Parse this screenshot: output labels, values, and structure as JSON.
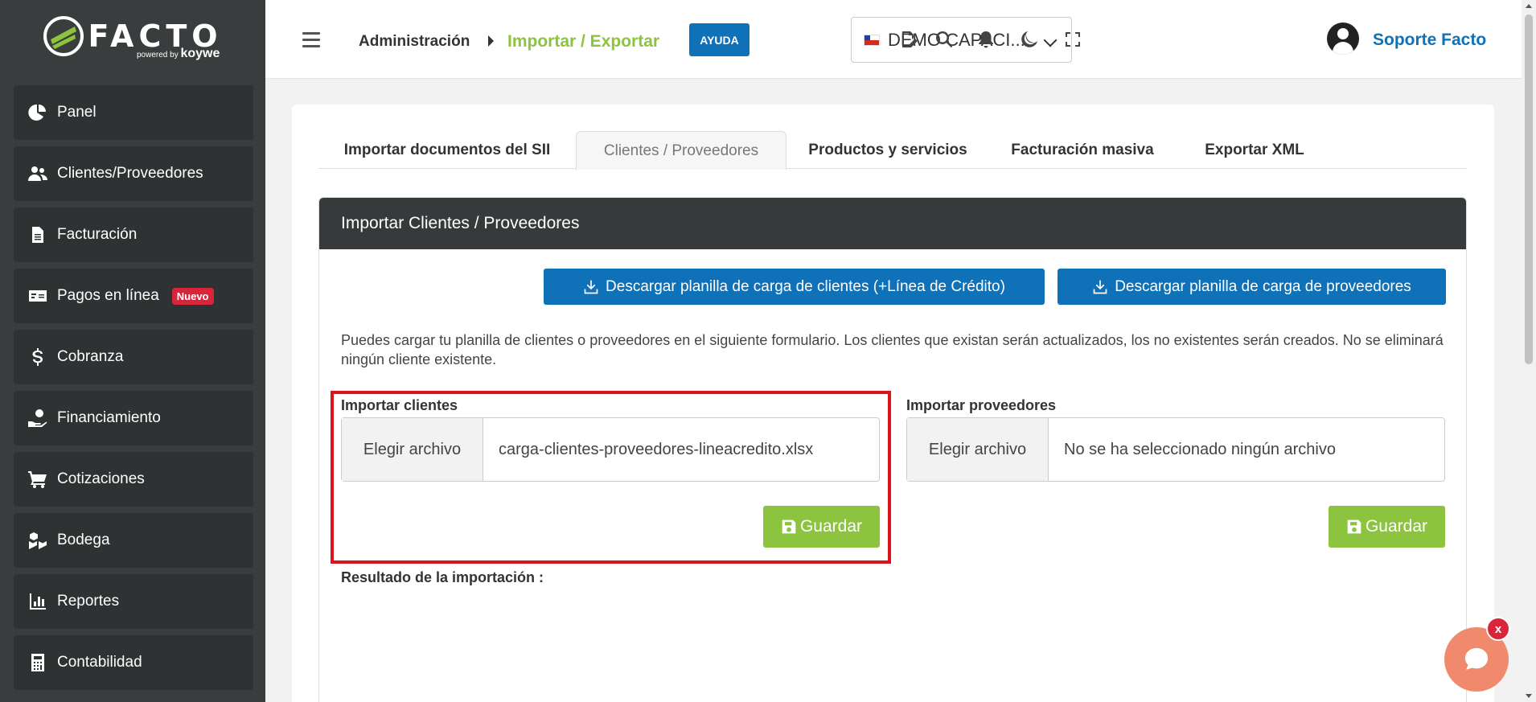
{
  "brand": {
    "name": "FACTO",
    "powered_by": "powered by",
    "partner": "koywe"
  },
  "sidebar": {
    "items": [
      {
        "label": "Panel",
        "icon": "pie-chart-icon"
      },
      {
        "label": "Clientes/Proveedores",
        "icon": "users-icon"
      },
      {
        "label": "Facturación",
        "icon": "document-icon"
      },
      {
        "label": "Pagos en línea",
        "icon": "money-card-icon",
        "badge": "Nuevo"
      },
      {
        "label": "Cobranza",
        "icon": "dollar-icon"
      },
      {
        "label": "Financiamiento",
        "icon": "hand-dollar-icon"
      },
      {
        "label": "Cotizaciones",
        "icon": "cart-icon"
      },
      {
        "label": "Bodega",
        "icon": "boxes-icon"
      },
      {
        "label": "Reportes",
        "icon": "bar-chart-icon"
      },
      {
        "label": "Contabilidad",
        "icon": "calculator-icon"
      }
    ]
  },
  "header": {
    "breadcrumb_root": "Administración",
    "breadcrumb_current": "Importar / Exportar",
    "help_label": "AYUDA",
    "company": "DEMO CAPACI...",
    "user_name": "Soporte Facto"
  },
  "tabs": [
    {
      "label": "Importar documentos del SII",
      "active": false
    },
    {
      "label": "Clientes / Proveedores",
      "active": true
    },
    {
      "label": "Productos y servicios",
      "active": false
    },
    {
      "label": "Facturación masiva",
      "active": false
    },
    {
      "label": "Exportar XML",
      "active": false
    }
  ],
  "panel": {
    "title": "Importar Clientes / Proveedores",
    "download_clients": "Descargar planilla de carga de clientes (+Línea de Crédito)",
    "download_suppliers": "Descargar planilla de carga de proveedores",
    "info": "Puedes cargar tu planilla de clientes o proveedores en el siguiente formulario. Los clientes que existan serán actualizados, los no existentes serán creados. No se eliminará ningún cliente existente.",
    "clients": {
      "label": "Importar clientes",
      "choose": "Elegir archivo",
      "file": "carga-clientes-proveedores-lineacredito.xlsx",
      "save": "Guardar"
    },
    "suppliers": {
      "label": "Importar proveedores",
      "choose": "Elegir archivo",
      "file": "No se ha seleccionado ningún archivo",
      "save": "Guardar"
    },
    "result_label": "Resultado de la importación :"
  },
  "chat": {
    "close": "x"
  },
  "colors": {
    "sidebar_bg": "#3a3d3e",
    "accent_green": "#8cc43f",
    "primary_blue": "#0f71b8",
    "highlight_red": "#d9141c",
    "badge_red": "#d8253a",
    "chat_orange": "#f18a6c"
  }
}
